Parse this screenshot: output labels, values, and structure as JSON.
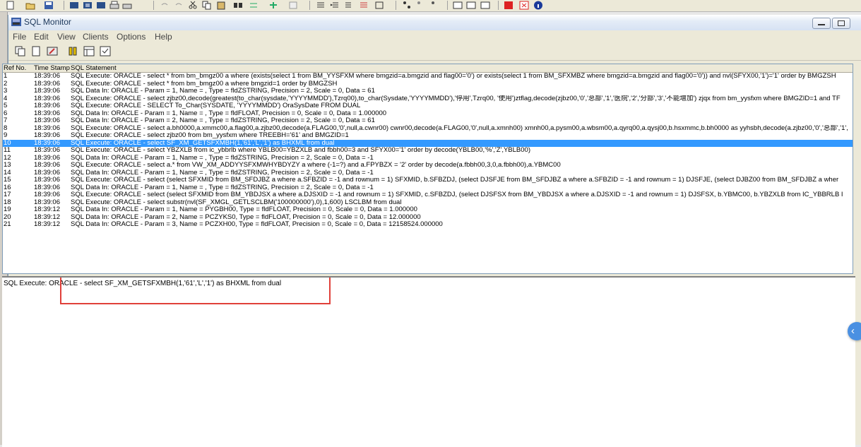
{
  "window": {
    "title": "SQL Monitor",
    "buttons": [
      "minimize-button",
      "maximize-button"
    ]
  },
  "menu": [
    {
      "label": "File"
    },
    {
      "label": "Edit"
    },
    {
      "label": "View"
    },
    {
      "label": "Clients"
    },
    {
      "label": "Options"
    },
    {
      "label": "Help"
    }
  ],
  "list": {
    "columns": [
      "Ref No.",
      "Time Stamp",
      "SQL Statement"
    ],
    "selected_row": 10,
    "rows": [
      {
        "ref": "1",
        "time": "18:39:06",
        "sql": "SQL Execute: ORACLE - select * from bm_bmgz00 a where  (exists(select 1 from BM_YYSFXM where bmgzid=a.bmgzid and flag00='0') or exists(select 1 from BM_SFXMBZ where bmgzid=a.bmgzid and flag00='0'))  and nvl(SFYX00,'1')='1'  order by BMGZSH"
      },
      {
        "ref": "2",
        "time": "18:39:06",
        "sql": "SQL Execute: ORACLE - select * from bm_bmgz00 a where bmgzid=1 order by BMGZSH"
      },
      {
        "ref": "3",
        "time": "18:39:06",
        "sql": "SQL Data In: ORACLE - Param = 1, Name = , Type = fldZSTRING, Precision = 2, Scale = 0, Data = 61"
      },
      {
        "ref": "4",
        "time": "18:39:06",
        "sql": "SQL Execute: ORACLE - select zjbz00,decode(greatest(to_char(sysdate,'YYYYMMDD'),Tzrq00),to_char(Sysdate,'YYYYMMDD'),'停用',Tzrq00, '使用')ztflag,decode(zjbz00,'0','总部','1','医院','2','分部','3','不能增加') zjqx from bm_yysfxm where BMGZID=1 and TF"
      },
      {
        "ref": "5",
        "time": "18:39:06",
        "sql": "SQL Execute: ORACLE - SELECT To_Char(SYSDATE, 'YYYYMMDD') OraSysDate FROM DUAL"
      },
      {
        "ref": "6",
        "time": "18:39:06",
        "sql": "SQL Data In: ORACLE - Param = 1, Name = , Type = fldFLOAT, Precision = 0, Scale = 0, Data = 1.000000"
      },
      {
        "ref": "7",
        "time": "18:39:06",
        "sql": "SQL Data In: ORACLE - Param = 2, Name = , Type = fldZSTRING, Precision = 2, Scale = 0, Data = 61"
      },
      {
        "ref": "8",
        "time": "18:39:06",
        "sql": "SQL Execute: ORACLE - select a.bh0000,a.xmmc00,a.flag00,a.zjbz00,decode(a.FLAG00,'0',null,a.cwnr00) cwnr00,decode(a.FLAG00,'0',null,a.xmnh00) xmnh00,a.pysm00,a.wbsm00,a.qyrq00,a.qysj00,b.hsxmmc,b.bh0000 as yyhsbh,decode(a.zjbz00,'0','总部','1',"
      },
      {
        "ref": "9",
        "time": "18:39:06",
        "sql": "SQL Execute: ORACLE - select zjbz00 from bm_yysfxm where TREEBH='61' and BMGZID=1"
      },
      {
        "ref": "10",
        "time": "18:39:06",
        "sql": "SQL Execute: ORACLE - select SF_XM_GETSFXMBH(1,'61','L','1') as BHXML from dual"
      },
      {
        "ref": "11",
        "time": "18:39:06",
        "sql": "SQL Execute: ORACLE - select YBZXLB from ic_ybbrlb where YBLB00=YBZXLB and fbbh00=3 and SFYX00='1' order by decode(YBLB00,'%','Z',YBLB00)"
      },
      {
        "ref": "12",
        "time": "18:39:06",
        "sql": "SQL Data In: ORACLE - Param = 1, Name = , Type = fldZSTRING, Precision = 2, Scale = 0, Data = -1"
      },
      {
        "ref": "13",
        "time": "18:39:06",
        "sql": "SQL Execute: ORACLE -  select a.* from VW_XM_ADDYYSFXMWHYBDYZY a where (-1=?) and a.FPYBZX = '2' order by decode(a.fbbh00,3,0,a.fbbh00),a.YBMC00"
      },
      {
        "ref": "14",
        "time": "18:39:06",
        "sql": "SQL Data In: ORACLE - Param = 1, Name = , Type = fldZSTRING, Precision = 2, Scale = 0, Data = -1"
      },
      {
        "ref": "15",
        "time": "18:39:06",
        "sql": "SQL Execute: ORACLE -  select (select SFXMID from BM_SFDJBZ a where a.SFBZID = -1 and rownum = 1) SFXMID, b.SFBZDJ,   (select DJSFJE from BM_SFDJBZ a where a.SFBZID = -1 and rownum = 1) DJSFJE,   (select DJBZ00 from BM_SFDJBZ a wher"
      },
      {
        "ref": "16",
        "time": "18:39:06",
        "sql": "SQL Data In: ORACLE - Param = 1, Name = , Type = fldZSTRING, Precision = 2, Scale = 0, Data = -1"
      },
      {
        "ref": "17",
        "time": "18:39:06",
        "sql": "SQL Execute: ORACLE -  select (select SFXMID from BM_YBDJSX a where a.DJSXID = -1 and rownum = 1) SFXMID, c.SFBZDJ,   (select DJSFSX from BM_YBDJSX a where a.DJSXID = -1 and rownum = 1) DJSFSX, b.YBMC00, b.YBZXLB  from IC_YBBRLB I"
      },
      {
        "ref": "18",
        "time": "18:39:06",
        "sql": "SQL Execute: ORACLE -  select substr(nvl(SF_XMGL_GETLSCLBM('100000000'),0),1,600) LSCLBM from dual"
      },
      {
        "ref": "19",
        "time": "18:39:12",
        "sql": "SQL Data In: ORACLE - Param = 1, Name = PYGBH00, Type = fldFLOAT, Precision = 0, Scale = 0, Data = 1.000000"
      },
      {
        "ref": "20",
        "time": "18:39:12",
        "sql": "SQL Data In: ORACLE - Param = 2, Name = PCZYKS0, Type = fldFLOAT, Precision = 0, Scale = 0, Data = 12.000000"
      },
      {
        "ref": "21",
        "time": "18:39:12",
        "sql": "SQL Data In: ORACLE - Param = 3, Name = PCZXH00, Type = fldFLOAT, Precision = 0, Scale = 0, Data = 12158524.000000"
      }
    ]
  },
  "detail": {
    "text": "SQL Execute: ORACLE - select SF_XM_GETSFXMBH(1,'61','L','1') as BHXML from dual"
  },
  "colors": {
    "selection": "#3399ff",
    "highlight_box": "#e0403a",
    "collapse_button": "#4a90e2"
  },
  "icons": [
    "app-icon",
    "collapse-arrow-icon"
  ]
}
